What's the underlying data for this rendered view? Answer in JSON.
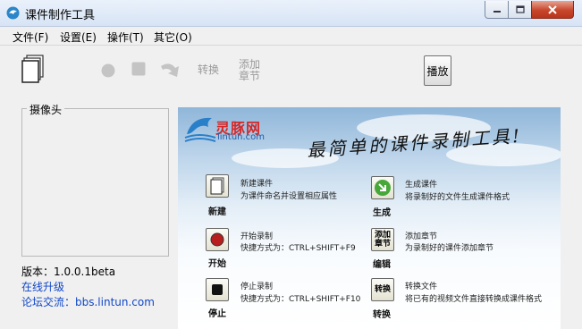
{
  "window": {
    "title": "课件制作工具"
  },
  "menu": {
    "items": [
      "文件(F)",
      "设置(E)",
      "操作(T)",
      "其它(O)"
    ]
  },
  "toolbar": {
    "convert_label": "转换",
    "add_label_1": "添加",
    "add_label_2": "章节",
    "play_label": "播放"
  },
  "camera": {
    "label": "摄像头"
  },
  "info": {
    "version": "版本：1.0.0.1beta",
    "upgrade": "在线升级",
    "forum": "论坛交流：bbs.lintun.com"
  },
  "banner": {
    "logo_name": "灵豚网",
    "logo_url": "lintun.com",
    "slogan": "最简单的课件录制工具!",
    "features": [
      {
        "label": "新建",
        "title": "新建课件",
        "desc": "为课件命名并设置相应属性",
        "icon": "new-document-icon"
      },
      {
        "label": "生成",
        "title": "生成课件",
        "desc": "将录制好的文件生成课件格式",
        "icon": "green-arrow-icon"
      },
      {
        "label": "开始",
        "title": "开始录制",
        "desc": "快捷方式为：CTRL+SHIFT+F9",
        "icon": "record-icon"
      },
      {
        "label": "编辑",
        "title": "添加章节",
        "desc": "为录制好的课件添加章节",
        "icon_text": "添加\n章节"
      },
      {
        "label": "停止",
        "title": "停止录制",
        "desc": "快捷方式为：CTRL+SHIFT+F10",
        "icon": "stop-icon"
      },
      {
        "label": "转换",
        "title": "转换文件",
        "desc": "将已有的视频文件直接转换成课件格式",
        "icon_text": "转换"
      }
    ]
  },
  "colors": {
    "link": "#1047c8",
    "logo_red": "#d52828",
    "close_red": "#c7472c"
  }
}
